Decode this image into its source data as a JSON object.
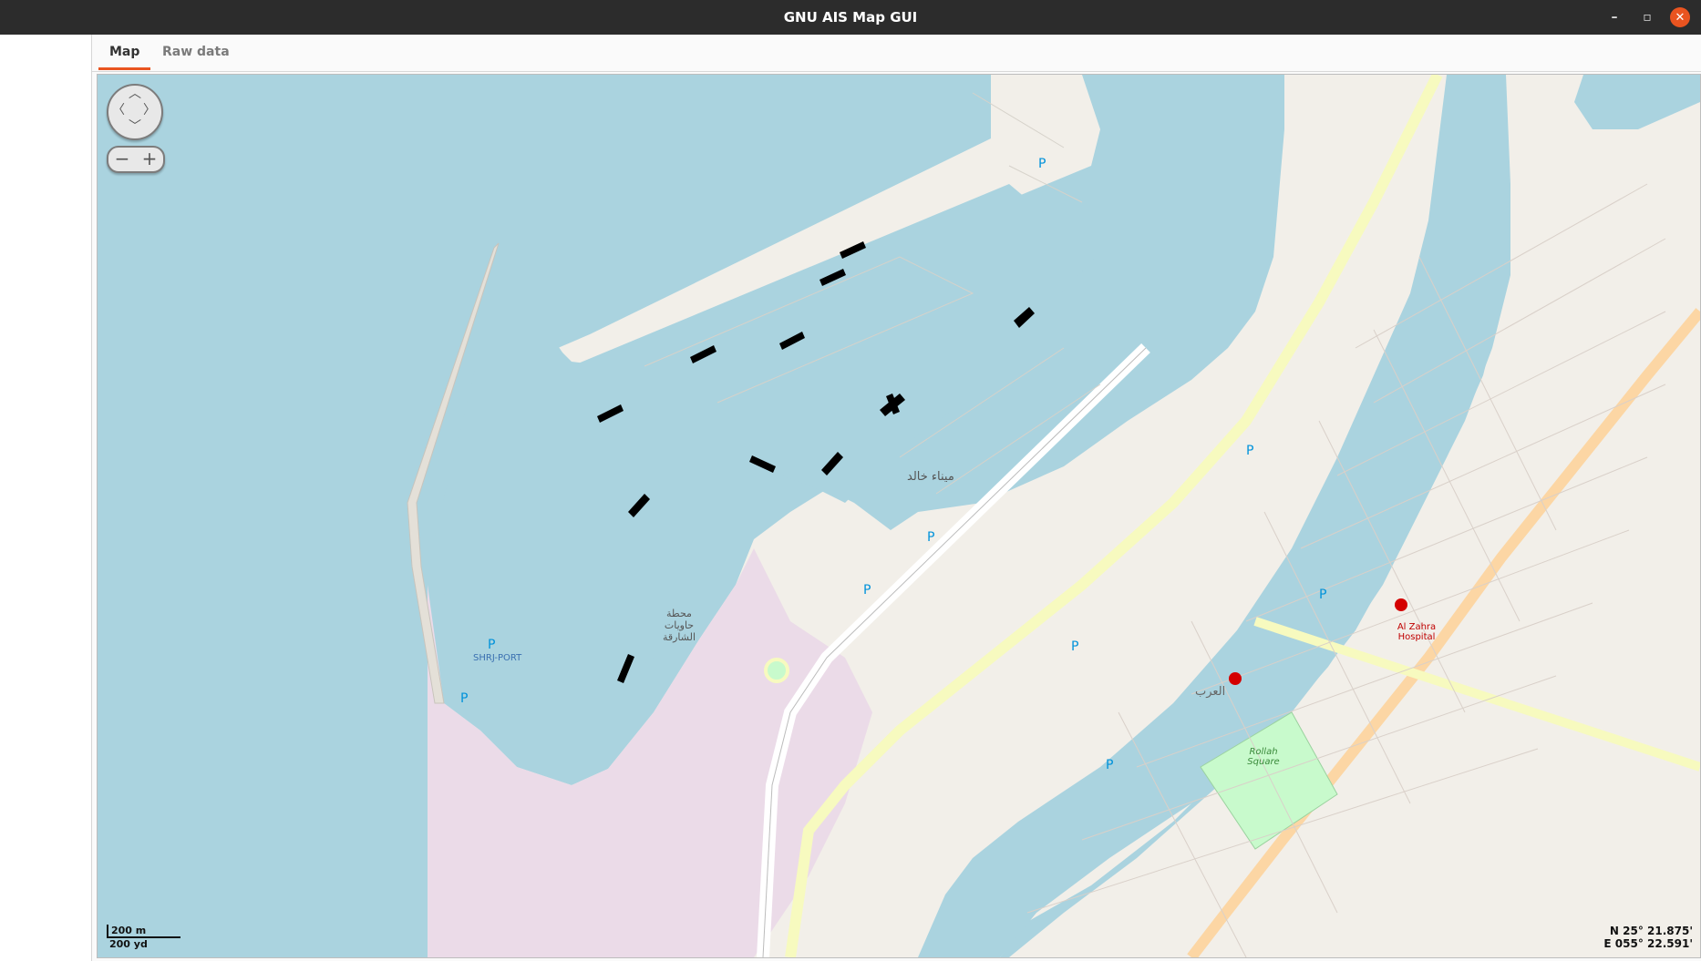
{
  "window": {
    "title": "GNU AIS Map GUI",
    "minimize": "–",
    "maximize": "▫",
    "close": "✕"
  },
  "tabs": [
    {
      "label": "Map",
      "active": true
    },
    {
      "label": "Raw data",
      "active": false
    }
  ],
  "map": {
    "labels": {
      "port": "ميناء خالد",
      "container_station": "محطة حاويات الشارقة",
      "port_code": "SHRJ-PORT",
      "hospital": "Al Zahra Hospital",
      "square": "Rollah Square",
      "district": "العرب",
      "parking": "P"
    },
    "scale": {
      "metric": "200 m",
      "imperial": "200 yd"
    },
    "coords": {
      "lat": "N 25° 21.875'",
      "lon": "E 055° 22.591'"
    },
    "colors": {
      "water": "#aad3df",
      "land": "#f2efe9",
      "industrial": "#ebdbe8",
      "road_major": "#f7fabf",
      "road_orange": "#fcd6a4",
      "park": "#c8facc",
      "vessel": "#000000"
    }
  }
}
